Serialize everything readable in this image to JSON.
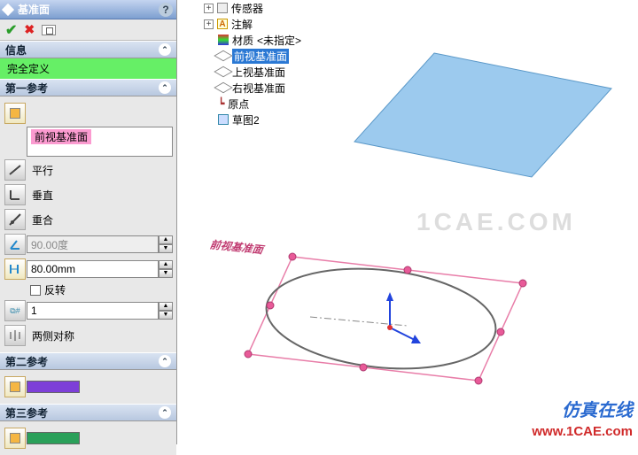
{
  "panel": {
    "title": "基准面",
    "help": "?",
    "info_header": "信息",
    "fully_defined": "完全定义",
    "ref1_header": "第一参考",
    "ref1_selection": "前视基准面",
    "opt_parallel": "平行",
    "opt_perp": "垂直",
    "opt_coincident": "重合",
    "angle_value": "90.00度",
    "distance_value": "80.00mm",
    "flip_label": "反转",
    "count_value": "1",
    "symmetric_label": "两侧对称",
    "ref2_header": "第二参考",
    "ref3_header": "第三参考"
  },
  "tree": {
    "n0": "传感器",
    "n1": "注解",
    "n2a": "材质",
    "n2b": "<未指定>",
    "n3": "前视基准面",
    "n4": "上视基准面",
    "n5": "右视基准面",
    "n6": "原点",
    "n7": "草图2"
  },
  "scene": {
    "plane_label": "前视基准面"
  },
  "brand": "仿真在线",
  "url": "www.1CAE.com",
  "watermark": "1CAE.COM"
}
